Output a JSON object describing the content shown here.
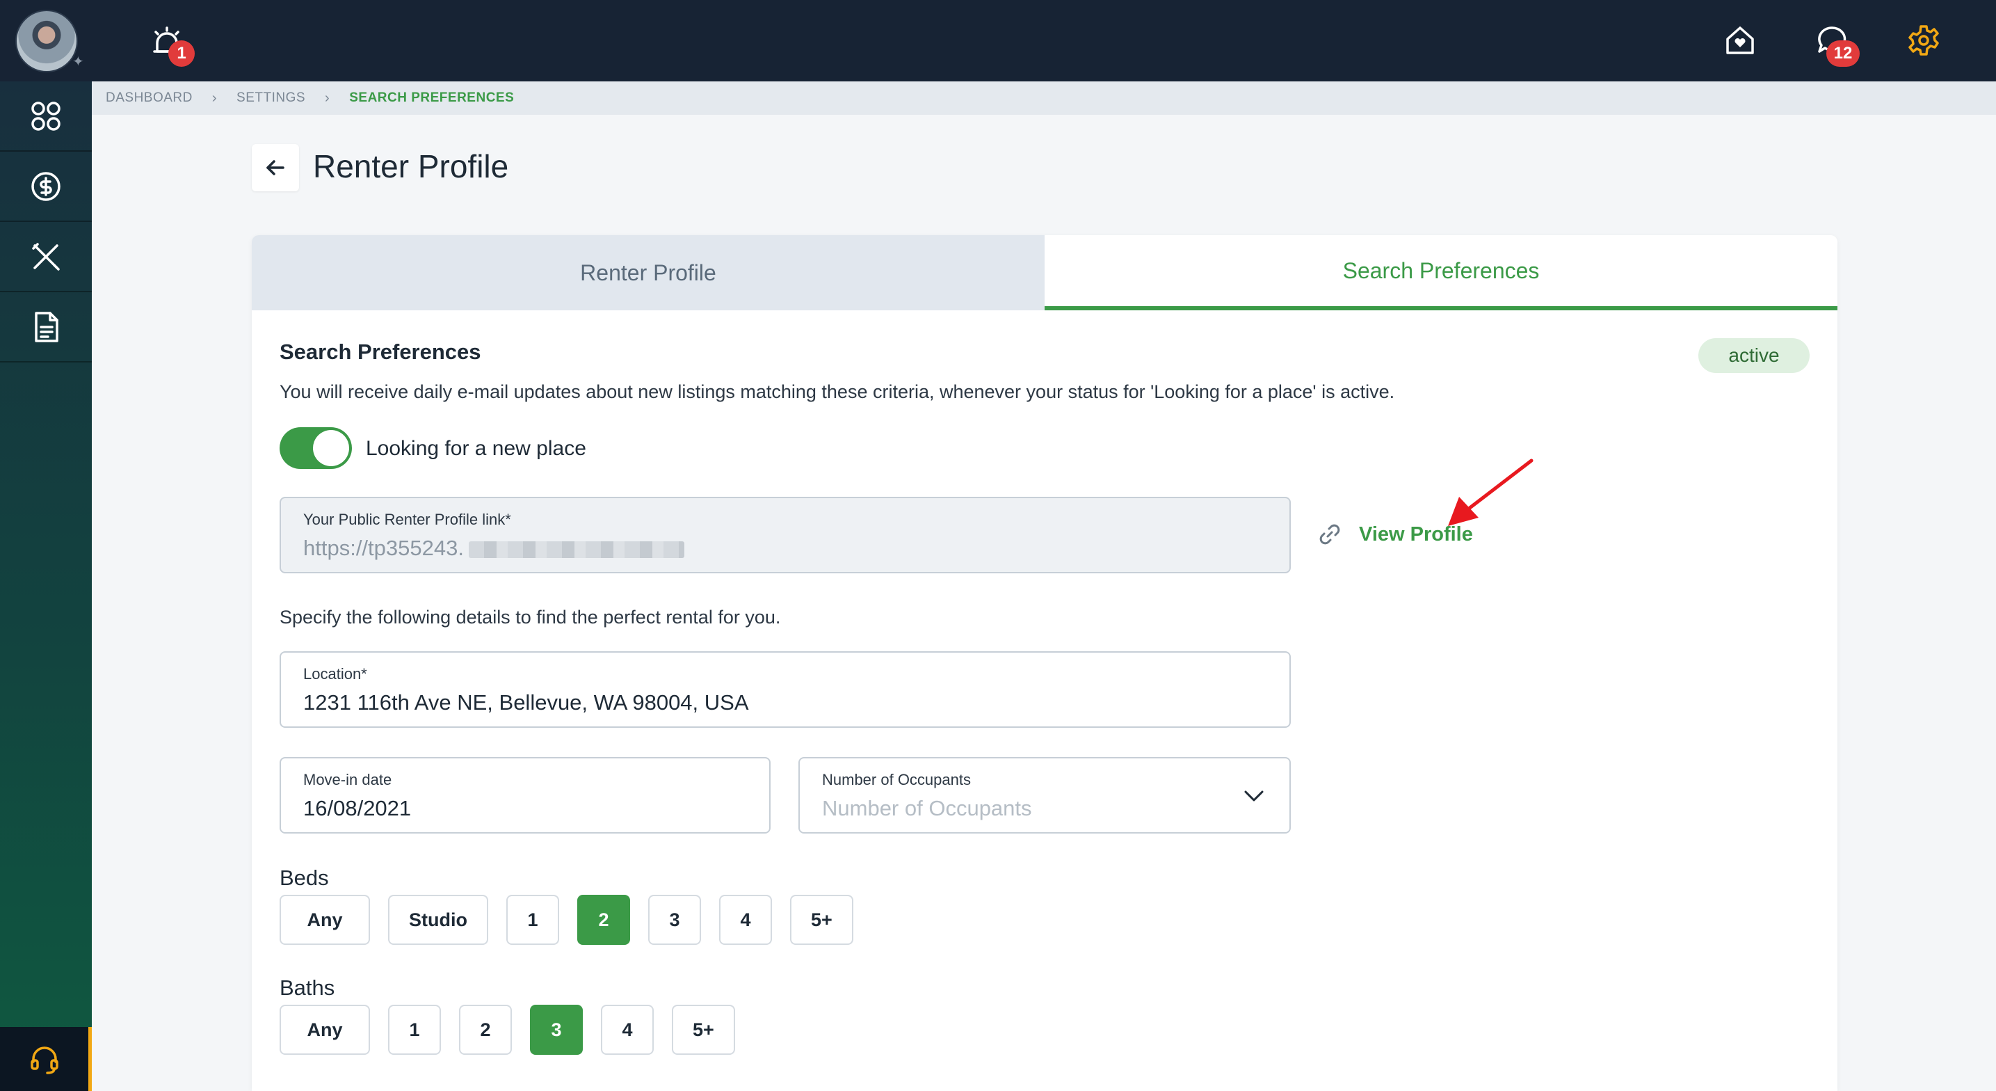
{
  "topbar": {
    "alarm_badge": "1",
    "chat_badge": "12",
    "accent_color": "#f2a814"
  },
  "sidebar": {
    "items": [
      {
        "icon": "dashboard-grid-icon"
      },
      {
        "icon": "dollar-circle-icon"
      },
      {
        "icon": "tools-icon"
      },
      {
        "icon": "document-icon"
      }
    ],
    "support_icon": "headset-icon"
  },
  "breadcrumb": {
    "items": [
      "DASHBOARD",
      "SETTINGS",
      "SEARCH PREFERENCES"
    ]
  },
  "header": {
    "title": "Renter Profile"
  },
  "tabs": [
    {
      "label": "Renter Profile"
    },
    {
      "label": "Search Preferences"
    }
  ],
  "section": {
    "title": "Search Preferences",
    "status": "active",
    "description": "You will receive daily e-mail updates about new listings matching these criteria, whenever your status for 'Looking for a place' is active."
  },
  "toggle": {
    "label": "Looking for a new place",
    "on": true
  },
  "public_link": {
    "label": "Your Public Renter Profile link*",
    "value": "https://tp355243."
  },
  "view_profile": {
    "label": "View Profile"
  },
  "hint": "Specify the following details to find the perfect rental for you.",
  "location": {
    "label": "Location*",
    "value": "1231 116th Ave NE, Bellevue, WA 98004, USA"
  },
  "move_in": {
    "label": "Move-in date",
    "value": "16/08/2021"
  },
  "occupants": {
    "label": "Number of Occupants",
    "placeholder": "Number of Occupants"
  },
  "beds": {
    "label": "Beds",
    "options": [
      "Any",
      "Studio",
      "1",
      "2",
      "3",
      "4",
      "5+"
    ],
    "selected": "2"
  },
  "baths": {
    "label": "Baths",
    "options": [
      "Any",
      "1",
      "2",
      "3",
      "4",
      "5+"
    ],
    "selected": "3"
  }
}
